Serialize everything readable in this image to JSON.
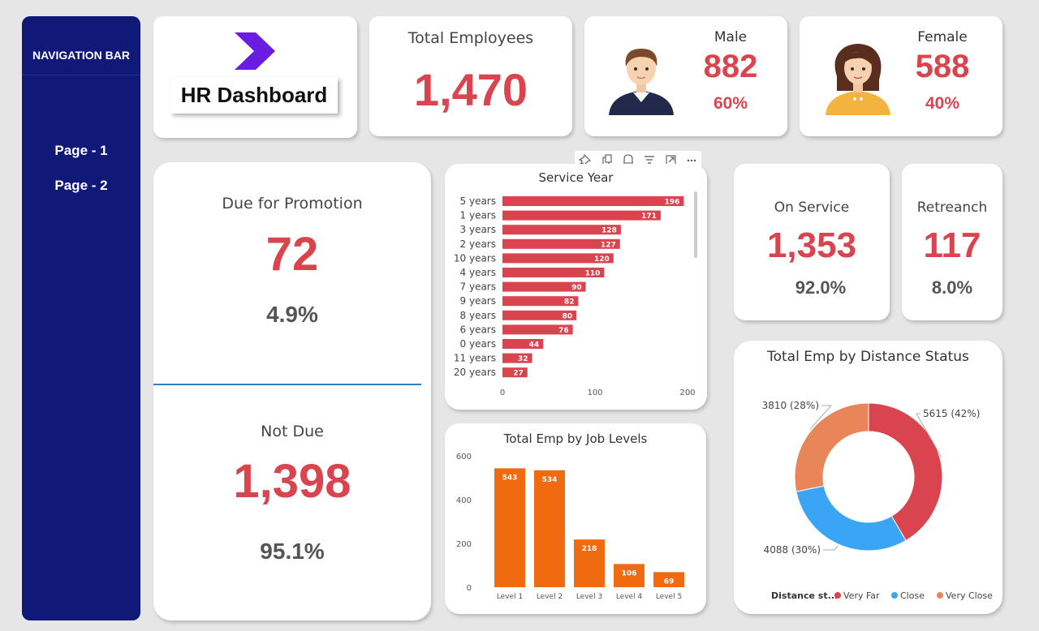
{
  "nav": {
    "title": "NAVIGATION BAR",
    "links": [
      "Page - 1",
      "Page - 2"
    ]
  },
  "header": {
    "title": "HR Dashboard",
    "total_label": "Total Employees",
    "total_value": "1,470"
  },
  "gender": {
    "male_label": "Male",
    "male_value": "882",
    "male_pct": "60%",
    "female_label": "Female",
    "female_value": "588",
    "female_pct": "40%"
  },
  "promotion": {
    "due_label": "Due for Promotion",
    "due_value": "72",
    "due_pct": "4.9%",
    "notdue_label": "Not Due",
    "notdue_value": "1,398",
    "notdue_pct": "95.1%"
  },
  "service_status": {
    "on_label": "On Service",
    "on_value": "1,353",
    "on_pct": "92.0%",
    "ret_label": "Retreanch",
    "ret_value": "117",
    "ret_pct": "8.0%"
  },
  "colors": {
    "accent_red": "#d9444e",
    "nav_blue": "#101878",
    "orange": "#f06a0f",
    "blue": "#3ba5f5",
    "salmon": "#e8865a"
  },
  "chart_data": [
    {
      "type": "bar",
      "orientation": "horizontal",
      "title": "Service Year",
      "categories": [
        "5 years",
        "1 years",
        "3 years",
        "2 years",
        "10 years",
        "4 years",
        "7 years",
        "9 years",
        "8 years",
        "6 years",
        "0 years",
        "11 years",
        "20 years"
      ],
      "values": [
        196,
        171,
        128,
        127,
        120,
        110,
        90,
        82,
        80,
        76,
        44,
        32,
        27
      ],
      "xticks": [
        0,
        100,
        200
      ],
      "xlim": [
        0,
        200
      ]
    },
    {
      "type": "bar",
      "title": "Total Emp by Job Levels",
      "categories": [
        "Level 1",
        "Level 2",
        "Level 3",
        "Level 4",
        "Level 5"
      ],
      "values": [
        543,
        534,
        218,
        106,
        69
      ],
      "yticks": [
        0,
        200,
        400,
        600
      ],
      "ylim": [
        0,
        600
      ]
    },
    {
      "type": "pie",
      "title": "Total Emp by Distance Status",
      "legend_title": "Distance st...",
      "categories": [
        "Very Far",
        "Close",
        "Very Close"
      ],
      "values": [
        5615,
        4088,
        3810
      ],
      "labels": [
        "5615 (42%)",
        "4088 (30%)",
        "3810 (28%)"
      ],
      "colors": [
        "#d9444e",
        "#3ba5f5",
        "#e8865a"
      ]
    }
  ]
}
